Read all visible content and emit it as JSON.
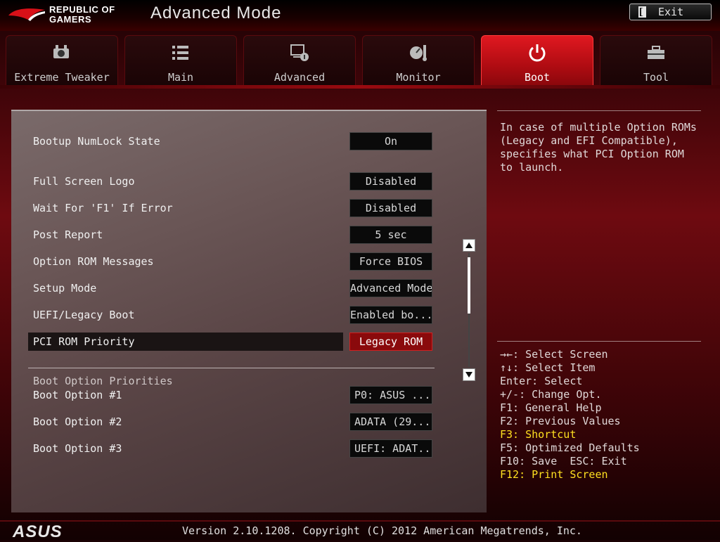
{
  "header": {
    "brand_line1": "REPUBLIC OF",
    "brand_line2": "GAMERS",
    "mode_title": "Advanced Mode",
    "exit_label": "Exit"
  },
  "tabs": [
    {
      "label": "Extreme Tweaker",
      "icon": "extreme-tweaker-icon",
      "active": false
    },
    {
      "label": "Main",
      "icon": "list-icon",
      "active": false
    },
    {
      "label": "Advanced",
      "icon": "advanced-icon",
      "active": false
    },
    {
      "label": "Monitor",
      "icon": "monitor-gauge-icon",
      "active": false
    },
    {
      "label": "Boot",
      "icon": "power-icon",
      "active": true
    },
    {
      "label": "Tool",
      "icon": "toolbox-icon",
      "active": false
    }
  ],
  "settings": [
    {
      "label": "Bootup NumLock State",
      "value": "On"
    },
    {
      "label": "Full Screen Logo",
      "value": "Disabled"
    },
    {
      "label": "Wait For 'F1' If Error",
      "value": "Disabled"
    },
    {
      "label": "Post Report",
      "value": "5 sec"
    },
    {
      "label": "Option ROM Messages",
      "value": "Force BIOS"
    },
    {
      "label": "Setup Mode",
      "value": "Advanced Mode"
    },
    {
      "label": "UEFI/Legacy Boot",
      "value": "Enabled bo..."
    },
    {
      "label": "PCI ROM Priority",
      "value": "Legacy ROM",
      "selected": true
    }
  ],
  "boot_section": {
    "title": "Boot Option Priorities",
    "options": [
      {
        "label": "Boot Option #1",
        "value": "P0: ASUS  ..."
      },
      {
        "label": "Boot Option #2",
        "value": "ADATA  (29..."
      },
      {
        "label": "Boot Option #3",
        "value": "UEFI: ADAT..."
      }
    ]
  },
  "help_text": "In case of multiple Option ROMs (Legacy and EFI Compatible), specifies what PCI Option ROM to launch.",
  "keys": [
    {
      "text": "→←: Select Screen",
      "highlight": false
    },
    {
      "text": "↑↓: Select Item",
      "highlight": false
    },
    {
      "text": "Enter: Select",
      "highlight": false
    },
    {
      "text": "+/-: Change Opt.",
      "highlight": false
    },
    {
      "text": "F1: General Help",
      "highlight": false
    },
    {
      "text": "F2: Previous Values",
      "highlight": false
    },
    {
      "text": "F3: Shortcut",
      "highlight": true
    },
    {
      "text": "F5: Optimized Defaults",
      "highlight": false
    },
    {
      "text": "F10: Save  ESC: Exit",
      "highlight": false
    },
    {
      "text": "F12: Print Screen",
      "highlight": true
    }
  ],
  "footer": {
    "brand": "ASUS",
    "version": "Version 2.10.1208. Copyright (C) 2012 American Megatrends, Inc."
  },
  "colors": {
    "accent_red": "#e01820",
    "highlight_yellow": "#ffe020",
    "selected_value_bg": "#8a0a0c"
  }
}
